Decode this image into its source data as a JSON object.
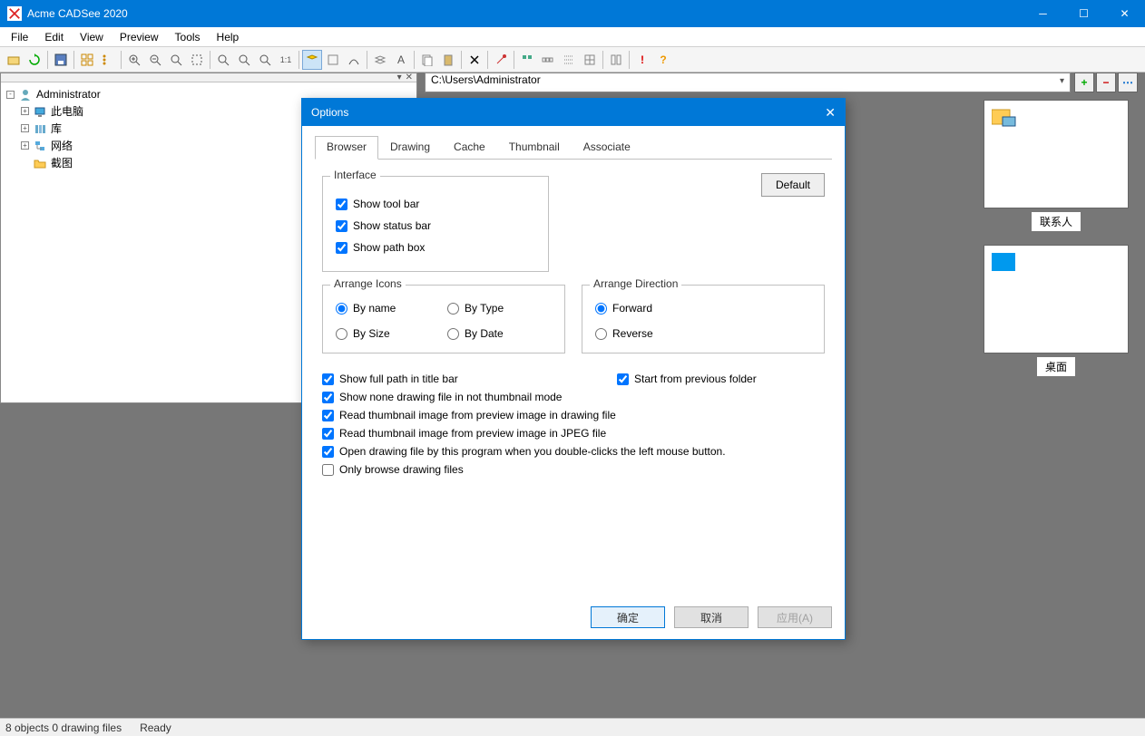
{
  "app": {
    "title": "Acme CADSee 2020"
  },
  "menu": {
    "file": "File",
    "edit": "Edit",
    "view": "View",
    "preview": "Preview",
    "tools": "Tools",
    "help": "Help"
  },
  "path": {
    "value": "C:\\Users\\Administrator"
  },
  "tree": {
    "root": "Administrator",
    "items": [
      "此电脑",
      "库",
      "网络",
      "截图"
    ]
  },
  "thumbs": {
    "t1": "联系人",
    "t2": "桌面"
  },
  "status": {
    "left": "8 objects 0 drawing files",
    "right": "Ready"
  },
  "dialog": {
    "title": "Options",
    "tabs": {
      "browser": "Browser",
      "drawing": "Drawing",
      "cache": "Cache",
      "thumbnail": "Thumbnail",
      "associate": "Associate"
    },
    "default_btn": "Default",
    "interface": {
      "legend": "Interface",
      "show_toolbar": "Show tool bar",
      "show_statusbar": "Show status bar",
      "show_pathbox": "Show path box"
    },
    "arrange_icons": {
      "legend": "Arrange Icons",
      "by_name": "By name",
      "by_type": "By Type",
      "by_size": "By Size",
      "by_date": "By Date"
    },
    "arrange_dir": {
      "legend": "Arrange Direction",
      "forward": "Forward",
      "reverse": "Reverse"
    },
    "opts": {
      "full_path": "Show full path in title bar",
      "start_prev": "Start from previous folder",
      "none_drawing": "Show none drawing file in not thumbnail mode",
      "read_thumb_dwg": "Read thumbnail image from preview image in drawing file",
      "read_thumb_jpg": "Read thumbnail image from preview image in JPEG file",
      "open_dbl": "Open drawing file by this program when you double-clicks the left mouse button.",
      "only_browse": "Only browse drawing files"
    },
    "buttons": {
      "ok": "确定",
      "cancel": "取消",
      "apply": "应用(A)"
    }
  }
}
